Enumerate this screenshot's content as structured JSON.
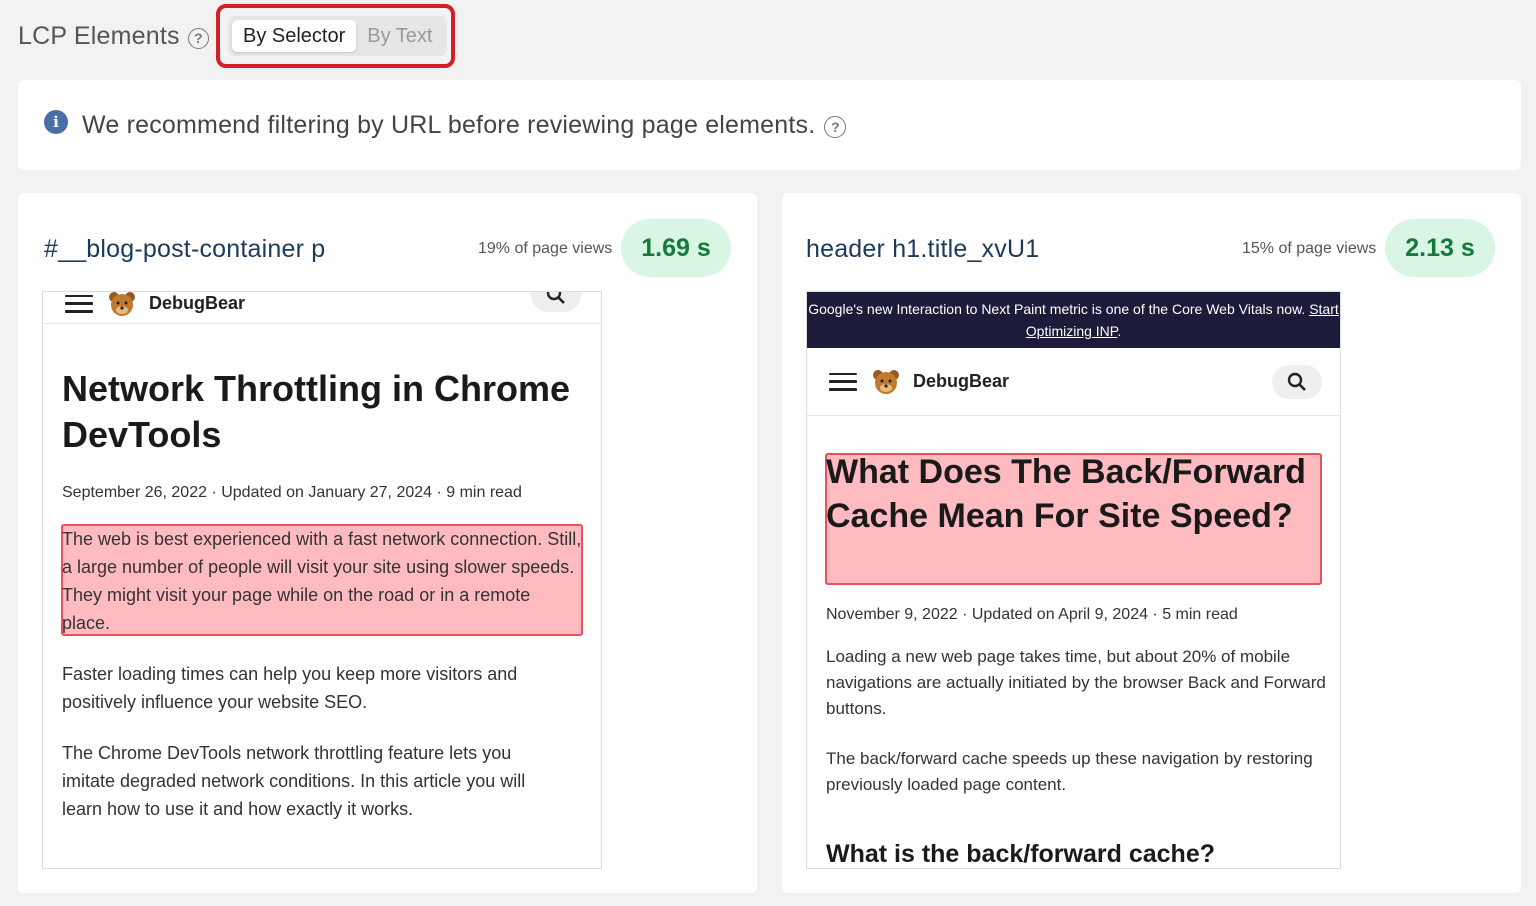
{
  "header": {
    "title": "LCP Elements",
    "help": "?",
    "toggle": {
      "by_selector": "By Selector",
      "by_text": "By Text",
      "active": "by_selector"
    }
  },
  "info": {
    "icon": "info-icon",
    "text": "We recommend filtering by URL before reviewing page elements.",
    "help": "?"
  },
  "colors": {
    "highlight_border": "#e8505b",
    "pill_bg": "#d9f5e3",
    "pill_text": "#147a3c",
    "toggle_border": "#d0202a"
  },
  "cards": [
    {
      "selector": "#__blog-post-container p",
      "views": "19% of page views",
      "lcp": "1.69 s",
      "preview": {
        "brand": "DebugBear",
        "title": "Network Throttling in Chrome DevTools",
        "meta": "September 26, 2022 · Updated on January 27, 2024 · 9 min read",
        "highlighted": "The web is best experienced with a fast network connection. Still, a large number of people will visit your site using slower speeds. They might visit your page while on the road or in a remote place.",
        "p1": "Faster loading times can help you keep more visitors and positively influence your website SEO.",
        "p2": "The Chrome DevTools network throttling feature lets you imitate degraded network conditions. In this article you will learn how to use it and how exactly it works."
      }
    },
    {
      "selector": "header h1.title_xvU1",
      "views": "15% of page views",
      "lcp": "2.13 s",
      "preview": {
        "banner_text": "Google's new Interaction to Next Paint metric is one of the Core Web Vitals now.",
        "banner_link": "Start Optimizing INP",
        "banner_end": ".",
        "brand": "DebugBear",
        "title": "What Does The Back/Forward Cache Mean For Site Speed?",
        "meta": "November 9, 2022 · Updated on April 9, 2024 · 5 min read",
        "p1": "Loading a new web page takes time, but about 20% of mobile navigations are actually initiated by the browser Back and Forward buttons.",
        "p2": "The back/forward cache speeds up these navigation by restoring previously loaded page content.",
        "h2": "What is the back/forward cache?"
      }
    }
  ]
}
